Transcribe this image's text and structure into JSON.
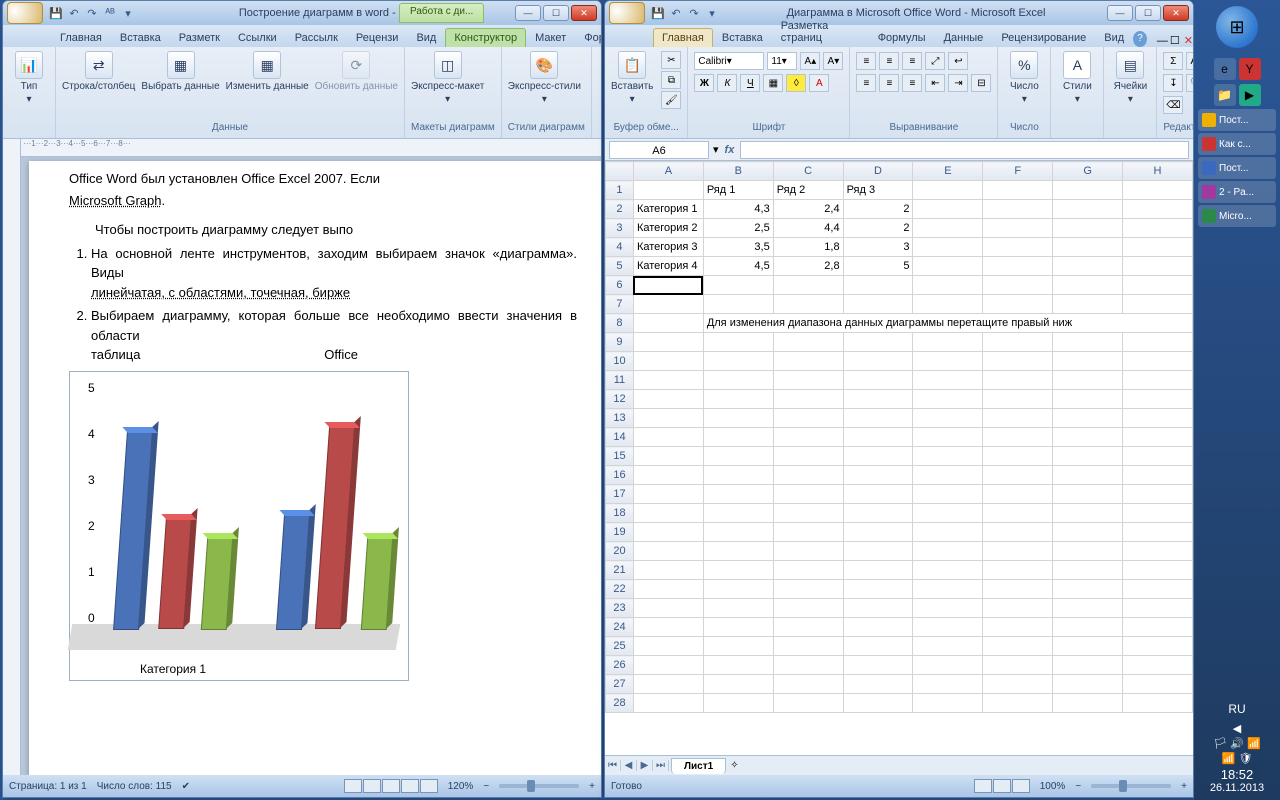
{
  "word": {
    "title": "Построение диаграмм в word - M...",
    "context_tab_group": "Работа с ди...",
    "qat_icons": [
      "save",
      "undo",
      "redo",
      "spell"
    ],
    "tabs": [
      "Главная",
      "Вставка",
      "Разметк",
      "Ссылки",
      "Рассылк",
      "Рецензи",
      "Вид",
      "Конструктор",
      "Макет",
      "Формат"
    ],
    "active_tab": "Конструктор",
    "ribbon": {
      "type_btn": "Тип",
      "groups": {
        "data": {
          "label": "Данные",
          "btns": [
            "Строка/столбец",
            "Выбрать данные",
            "Изменить данные",
            "Обновить данные"
          ]
        },
        "layouts": {
          "label": "Макеты диаграмм",
          "btn": "Экспресс-макет"
        },
        "styles": {
          "label": "Стили диаграмм",
          "btn": "Экспресс-стили"
        }
      }
    },
    "doc": {
      "para0": "Office Word был установлен Office Excel 2007. Если",
      "para0b": "Microsoft Graph",
      "para1": "Чтобы построить диаграмму следует выпо",
      "li1": "На основной ленте инструментов, заходим выбираем значок «диаграмма». Виды",
      "li1u": "линейчатая, с областями, точечная, бирже",
      "li2": "Выбираем диаграмму, которая больше все необходимо ввести значения в области",
      "li2a": "таблица",
      "li2b": "Office",
      "chart_category": "Категория 1"
    },
    "status": {
      "page": "Страница: 1 из 1",
      "words": "Число слов: 115",
      "zoom": "120%"
    }
  },
  "excel": {
    "title": "Диаграмма в Microsoft Office Word - Microsoft Excel",
    "tabs": [
      "Главная",
      "Вставка",
      "Разметка страниц",
      "Формулы",
      "Данные",
      "Рецензирование",
      "Вид"
    ],
    "active_tab": "Главная",
    "ribbon": {
      "clipboard": {
        "label": "Буфер обме...",
        "paste": "Вставить"
      },
      "font": {
        "label": "Шрифт",
        "name": "Calibri",
        "size": "11"
      },
      "align": {
        "label": "Выравнивание"
      },
      "number": {
        "label": "Число",
        "btn": "Число"
      },
      "styles": {
        "label": "",
        "btn": "Стили"
      },
      "cells": {
        "label": "",
        "btn": "Ячейки"
      },
      "editing": {
        "label": "Редактирова..."
      }
    },
    "name_box": "A6",
    "columns": [
      "A",
      "B",
      "C",
      "D",
      "E",
      "F",
      "G",
      "H"
    ],
    "rows": [
      {
        "n": 1,
        "cells": [
          "",
          "Ряд 1",
          "Ряд 2",
          "Ряд 3",
          "",
          "",
          "",
          ""
        ]
      },
      {
        "n": 2,
        "cells": [
          "Категория 1",
          "4,3",
          "2,4",
          "2",
          "",
          "",
          "",
          ""
        ]
      },
      {
        "n": 3,
        "cells": [
          "Категория 2",
          "2,5",
          "4,4",
          "2",
          "",
          "",
          "",
          ""
        ]
      },
      {
        "n": 4,
        "cells": [
          "Категория 3",
          "3,5",
          "1,8",
          "3",
          "",
          "",
          "",
          ""
        ]
      },
      {
        "n": 5,
        "cells": [
          "Категория 4",
          "4,5",
          "2,8",
          "5",
          "",
          "",
          "",
          ""
        ]
      },
      {
        "n": 6,
        "cells": [
          "",
          "",
          "",
          "",
          "",
          "",
          "",
          ""
        ]
      },
      {
        "n": 7,
        "cells": [
          "",
          "",
          "",
          "",
          "",
          "",
          "",
          ""
        ]
      },
      {
        "n": 8,
        "cells": [
          "",
          "Для изменения диапазона данных диаграммы перетащите правый ниж",
          "",
          "",
          "",
          "",
          "",
          ""
        ]
      }
    ],
    "extra_rows": [
      9,
      10,
      11,
      12,
      13,
      14,
      15,
      16,
      17,
      18,
      19,
      20,
      21,
      22,
      23,
      24,
      25,
      26,
      27,
      28
    ],
    "sheet_tab": "Лист1",
    "status": {
      "ready": "Готово",
      "zoom": "100%"
    }
  },
  "taskbar": {
    "tasks": [
      "Пост...",
      "Как с...",
      "Пост...",
      "2 - Pa...",
      "Micro..."
    ],
    "lang": "RU",
    "time": "18:52",
    "date": "26.11.2013"
  },
  "chart_data": {
    "type": "bar",
    "title": "",
    "xlabel": "",
    "ylabel": "",
    "ylim": [
      0,
      5
    ],
    "yticks": [
      0,
      1,
      2,
      3,
      4,
      5
    ],
    "categories": [
      "Категория 1",
      "Категория 2",
      "Категория 3",
      "Категория 4"
    ],
    "series": [
      {
        "name": "Ряд 1",
        "color": "#4a72b8",
        "values": [
          4.3,
          2.5,
          3.5,
          4.5
        ]
      },
      {
        "name": "Ряд 2",
        "color": "#b84a4a",
        "values": [
          2.4,
          4.4,
          1.8,
          2.8
        ]
      },
      {
        "name": "Ряд 3",
        "color": "#8ab84a",
        "values": [
          2,
          2,
          3,
          5
        ]
      }
    ]
  }
}
